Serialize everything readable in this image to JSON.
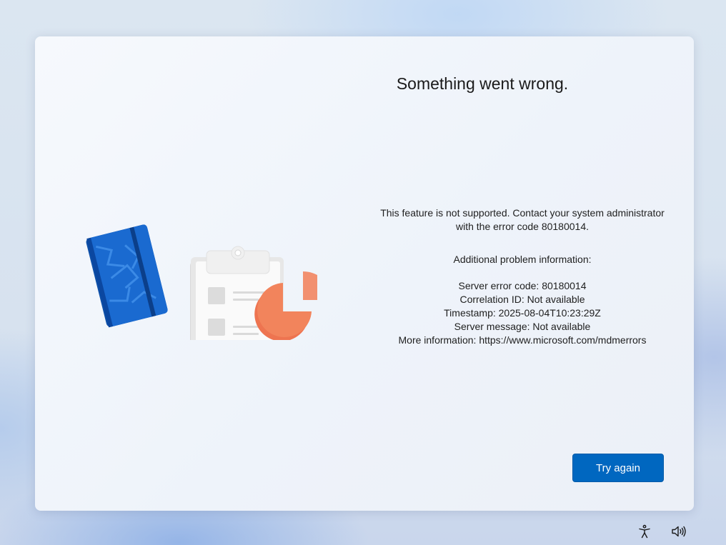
{
  "dialog": {
    "title": "Something went wrong.",
    "message": "This feature is not supported. Contact your system administrator with the error code 80180014.",
    "info_heading": "Additional problem information:",
    "info_lines": [
      "Server error code: 80180014",
      "Correlation ID: Not available",
      "Timestamp: 2025-08-04T10:23:29Z",
      "Server message: Not available",
      "More information: https://www.microsoft.com/mdmerrors"
    ],
    "try_again_label": "Try again"
  },
  "illustration": {
    "icons": [
      "notebook-icon",
      "clipboard-icon",
      "pie-chart-icon"
    ],
    "colors": {
      "notebook": "#1565c0",
      "pie": "#f07a55",
      "clipboard": "#f4f4f4"
    }
  },
  "taskbar": {
    "icons": [
      "accessibility-icon",
      "volume-icon"
    ]
  },
  "colors": {
    "accent": "#0067c0",
    "text": "#1a1a1a"
  }
}
